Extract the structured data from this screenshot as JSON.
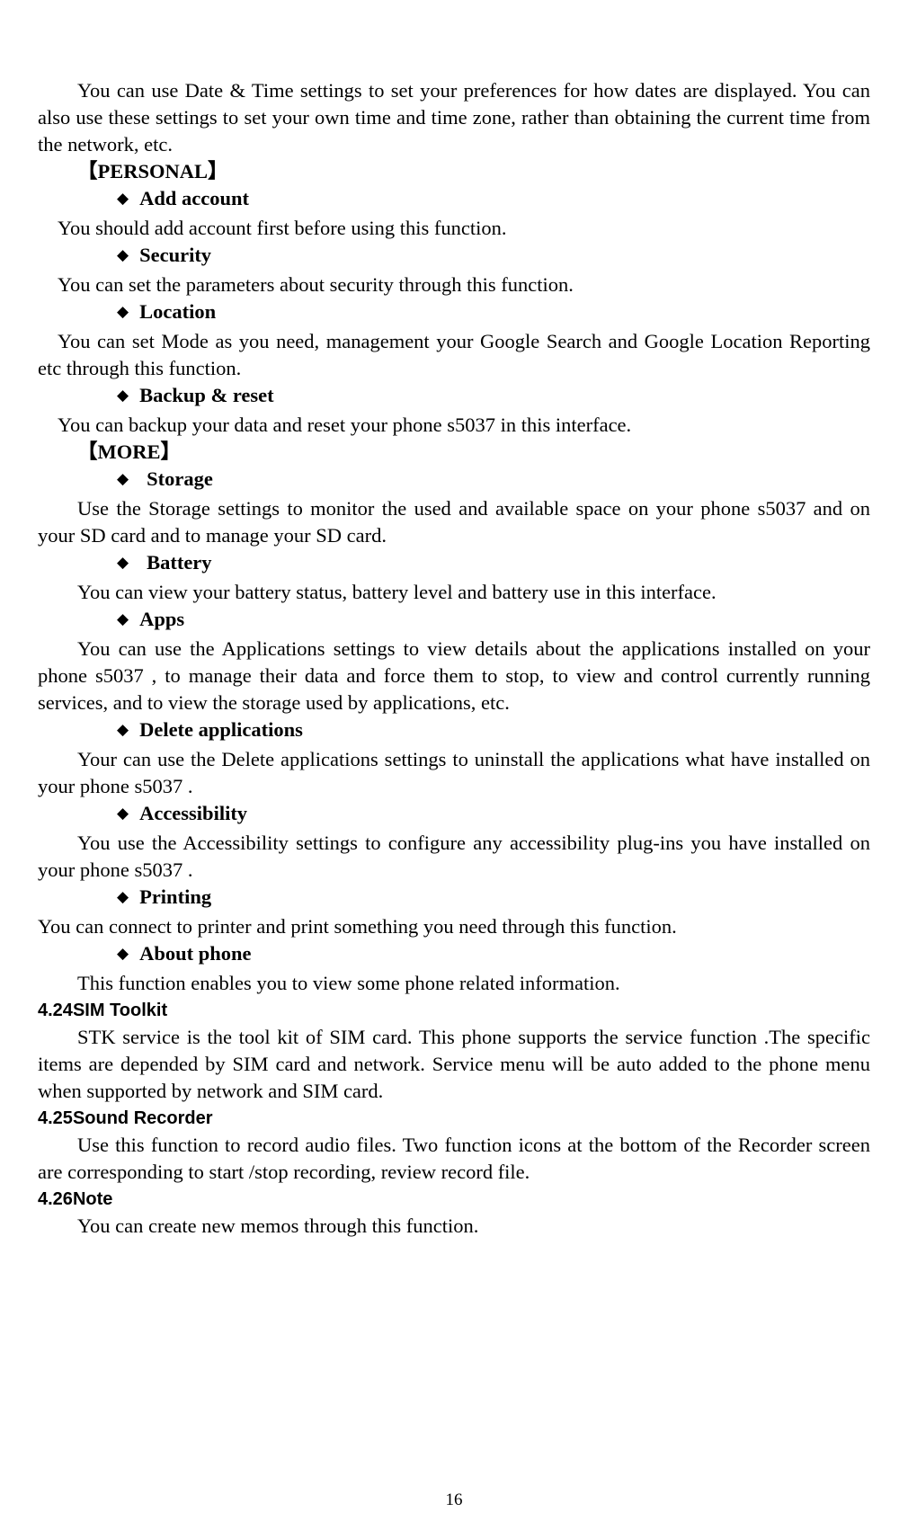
{
  "page": {
    "number": "16"
  },
  "intro": {
    "paragraph": "You can use Date & Time settings to set your preferences for how dates are displayed. You can also use these settings to set your own time and time zone, rather than obtaining the current time from the network, etc."
  },
  "sections": [
    {
      "heading": "【PERSONAL】",
      "items": [
        {
          "bullet": "◆",
          "label": "Add account",
          "text": "You should add account first before using this function."
        },
        {
          "bullet": "◆",
          "label": "Security",
          "text": "You can set the parameters about security through this function."
        },
        {
          "bullet": "◆",
          "label": "Location",
          "text": "You can set Mode as you need, management your Google Search and Google Location Reporting etc through this function."
        },
        {
          "bullet": "◆",
          "label": "Backup & reset",
          "text": "You can backup your data and reset your phone s5037    in this interface."
        }
      ]
    },
    {
      "heading": "【MORE】",
      "items": [
        {
          "bullet": "◆",
          "label": "Storage",
          "text": "Use the Storage settings to monitor the used and available space on your phone s5037    and on your SD card and to manage your SD card."
        },
        {
          "bullet": "◆",
          "label": "Battery",
          "text": "You can view your battery status, battery level and battery use in this interface."
        },
        {
          "bullet": "◆",
          "label": "Apps",
          "text": "You can use the Applications settings to view details about the applications installed on your phone s5037 , to manage their data and force them to stop, to view and control currently running services, and to view the storage used by applications, etc."
        },
        {
          "bullet": "◆",
          "label": "Delete applications",
          "text": "Your can use the Delete applications settings to uninstall the applications what have installed on your phone s5037 ."
        },
        {
          "bullet": "◆",
          "label": "Accessibility",
          "text": "You use the Accessibility settings to configure any accessibility plug-ins you have installed on your phone s5037 ."
        },
        {
          "bullet": "◆",
          "label": "Printing",
          "text": "You can connect to printer and print something you need through this function."
        },
        {
          "bullet": "◆",
          "label": "About phone",
          "text": "This function enables you to view some phone related information."
        }
      ]
    }
  ],
  "numbered_sections": [
    {
      "number": "4.24",
      "title": "SIM Toolkit",
      "body": "STK service is the tool kit of SIM card. This phone supports the service function .The specific items are depended by SIM card and network. Service menu will be auto added to the phone menu when supported by network and SIM card."
    },
    {
      "number": "4.25",
      "title": "Sound Recorder",
      "body": "Use this function to record audio files. Two function icons at the bottom of the Recorder screen are corresponding to start /stop recording, review record file."
    },
    {
      "number": "4.26",
      "title": "Note",
      "body": "You can create new memos through this function."
    }
  ]
}
